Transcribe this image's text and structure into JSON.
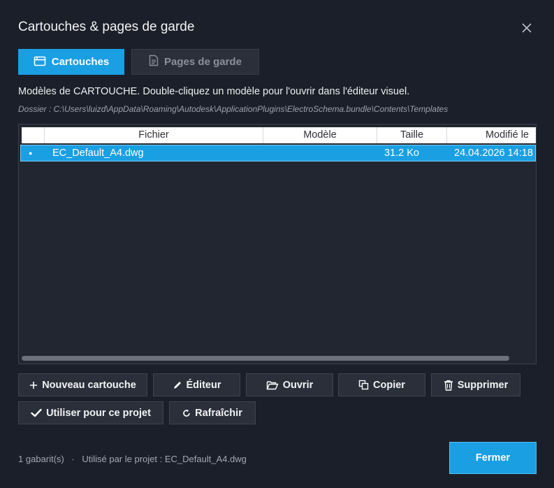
{
  "dialog": {
    "title": "Cartouches & pages de garde",
    "close_icon": "close-icon"
  },
  "tabs": [
    {
      "label": "Cartouches",
      "icon": "cartouche-icon",
      "active": true
    },
    {
      "label": "Pages de garde",
      "icon": "document-icon",
      "active": false
    }
  ],
  "description": "Modèles de CARTOUCHE. Double-cliquez un modèle pour l'ouvrir dans l'éditeur visuel.",
  "folder_path": "Dossier : C:\\Users\\luizd\\AppData\\Roaming\\Autodesk\\ApplicationPlugins\\ElectroSchema.bundle\\Contents\\Templates",
  "table": {
    "columns": [
      "Fichier",
      "Modèle",
      "Taille",
      "Modifié le"
    ],
    "rows": [
      {
        "marker": "●",
        "file": "EC_Default_A4.dwg",
        "model": "",
        "size": "31.2 Ko",
        "modified": "24.04.2026 14:18",
        "selected": true
      }
    ]
  },
  "buttons": {
    "new": {
      "label": "Nouveau cartouche",
      "icon": "plus-icon"
    },
    "editor": {
      "label": "Éditeur",
      "icon": "pencil-icon"
    },
    "open": {
      "label": "Ouvrir",
      "icon": "folder-open-icon"
    },
    "copy": {
      "label": "Copier",
      "icon": "copy-icon"
    },
    "delete": {
      "label": "Supprimer",
      "icon": "trash-icon"
    },
    "use": {
      "label": "Utiliser pour ce projet",
      "icon": "check-icon"
    },
    "refresh": {
      "label": "Rafraîchir",
      "icon": "refresh-icon"
    },
    "close": {
      "label": "Fermer"
    }
  },
  "status": {
    "count": "1 gabarit(s)",
    "separator": "·",
    "used": "Utilisé par le projet : EC_Default_A4.dwg"
  },
  "colors": {
    "accent": "#1a9fe3",
    "background": "#1b1f29",
    "button": "#2a2f3a"
  }
}
